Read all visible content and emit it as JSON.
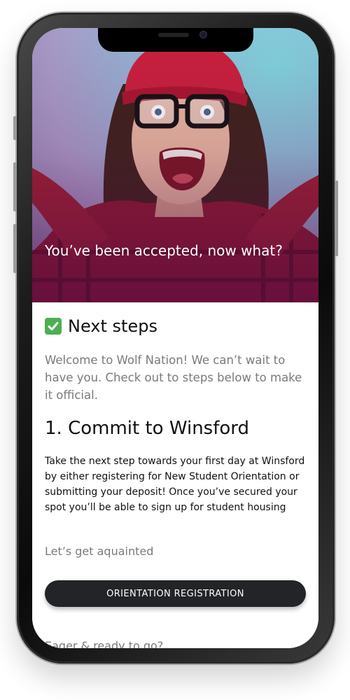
{
  "hero": {
    "title": "You’ve been accepted, now what?"
  },
  "content": {
    "section_icon": "check-mark-icon",
    "section_title": "Next steps",
    "intro": "Welcome to Wolf Nation! We can’t wait to have you. Check out to steps below to make it official.",
    "step_title": "1. Commit to Winsford",
    "step_body": "Take the next step towards your first day at Winsford by either registering for New Student Orientation or submitting your deposit! Once you’ve secured your spot you’ll be able to sign up for student housing",
    "acquainted": "Let’s get aquainted",
    "cta_label": "ORIENTATION REGISTRATION",
    "eager": "Eager & ready to go?"
  },
  "colors": {
    "check_green": "#4caf50",
    "button_dark": "#222427",
    "muted_text": "#7a7a7a"
  }
}
